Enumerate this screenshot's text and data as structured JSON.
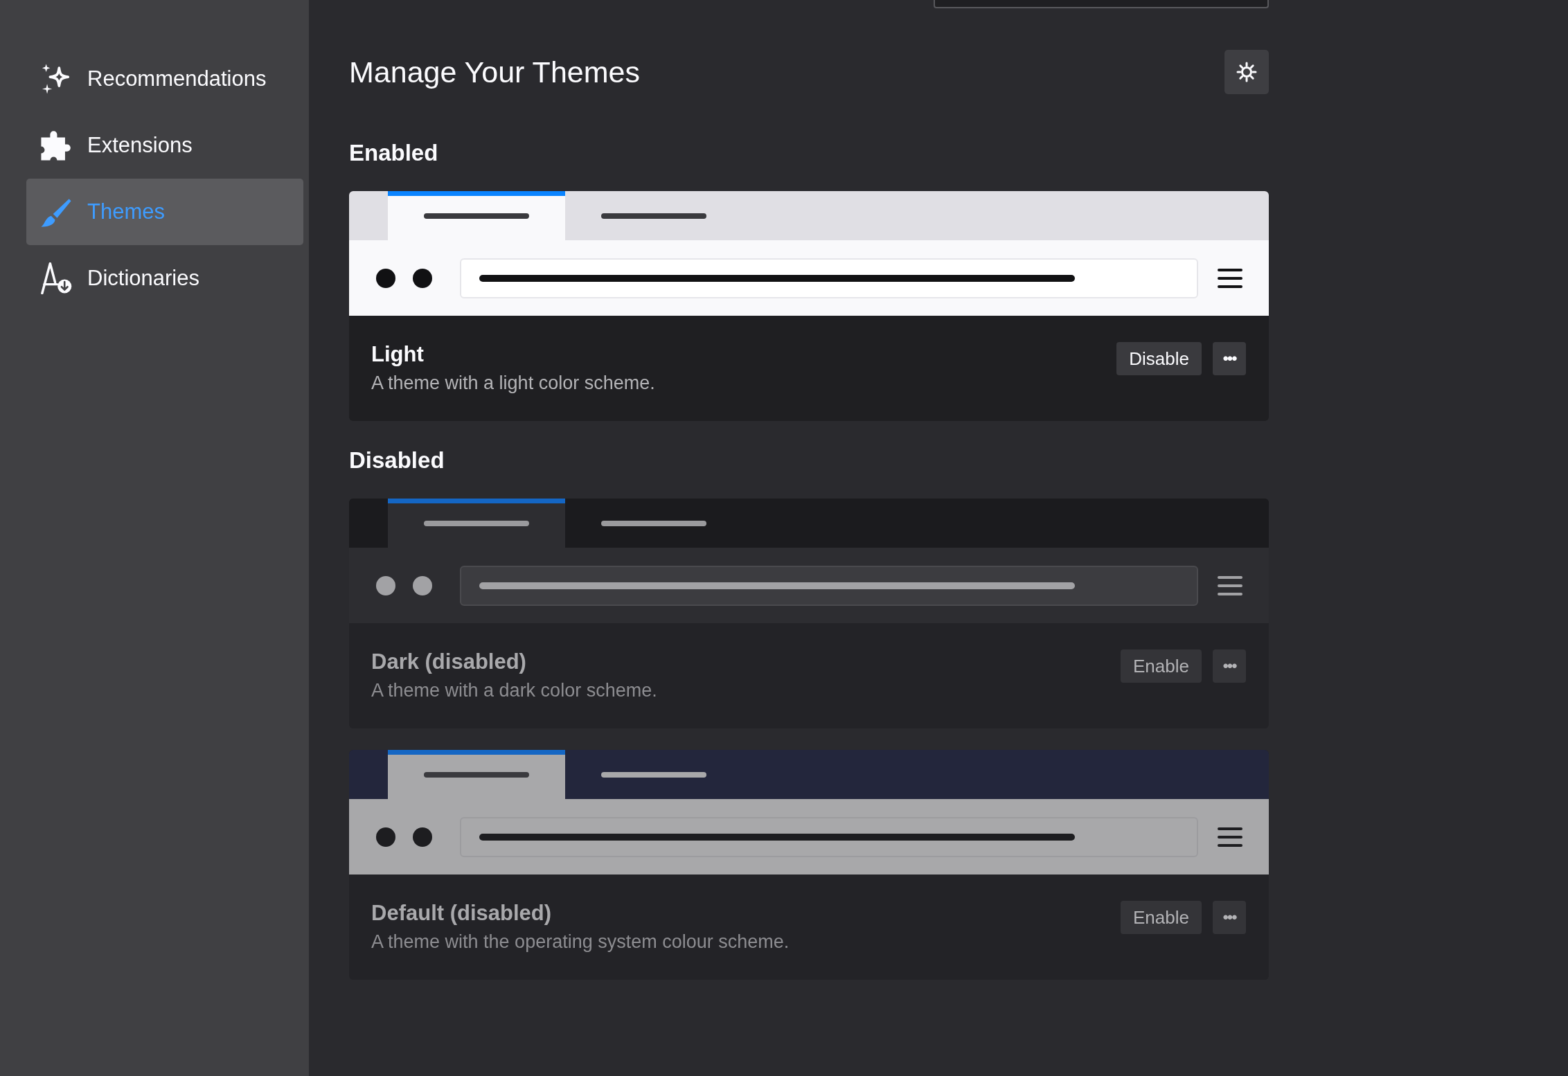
{
  "sidebar": {
    "items": [
      {
        "label": "Recommendations",
        "kind": "sparkle",
        "selected": false
      },
      {
        "label": "Extensions",
        "kind": "puzzle",
        "selected": false
      },
      {
        "label": "Themes",
        "kind": "brush",
        "selected": true
      },
      {
        "label": "Dictionaries",
        "kind": "dictionary",
        "selected": false
      }
    ]
  },
  "header": {
    "title": "Manage Your Themes"
  },
  "sections": [
    {
      "heading": "Enabled",
      "themes": [
        {
          "name": "Light",
          "description": "A theme with a light color scheme.",
          "kind": "light",
          "disabled": false,
          "button": "Disable",
          "more": "•••"
        }
      ]
    },
    {
      "heading": "Disabled",
      "themes": [
        {
          "name": "Dark (disabled)",
          "description": "A theme with a dark color scheme.",
          "kind": "dark",
          "disabled": true,
          "button": "Enable",
          "more": "•••"
        },
        {
          "name": "Default (disabled)",
          "description": "A theme with the operating system colour scheme.",
          "kind": "system",
          "disabled": true,
          "button": "Enable",
          "more": "•••"
        }
      ]
    }
  ]
}
